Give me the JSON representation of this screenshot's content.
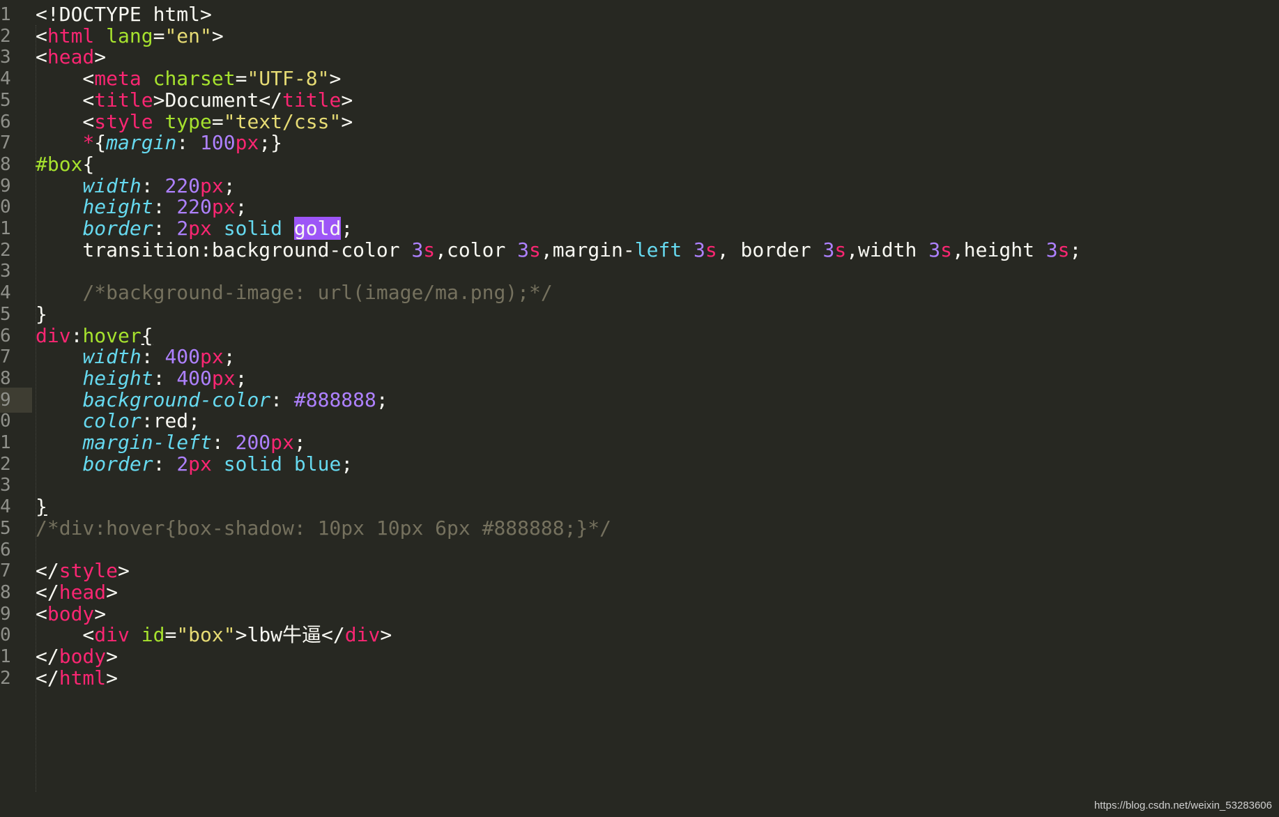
{
  "editor": {
    "theme_colors": {
      "background": "#272822",
      "tag": "#f92672",
      "attribute": "#a6e22e",
      "string": "#e6db74",
      "property": "#66d9ef",
      "number": "#ae81ff",
      "comment": "#75715e",
      "selection": "#9d55f7"
    },
    "active_line": 19,
    "line_numbers": [
      "1",
      "2",
      "3",
      "4",
      "5",
      "6",
      "7",
      "8",
      "9",
      "0",
      "1",
      "2",
      "3",
      "4",
      "5",
      "6",
      "7",
      "8",
      "9",
      "0",
      "1",
      "2",
      "3",
      "4",
      "5",
      "6",
      "7",
      "8",
      "9",
      "0",
      "1",
      "2"
    ],
    "lines": [
      [
        {
          "c": "t-punc",
          "t": "<!DOCTYPE html>"
        }
      ],
      [
        {
          "c": "t-punc",
          "t": "<"
        },
        {
          "c": "t-tag",
          "t": "html"
        },
        {
          "c": "t-punc",
          "t": " "
        },
        {
          "c": "t-attr",
          "t": "lang"
        },
        {
          "c": "t-punc",
          "t": "="
        },
        {
          "c": "t-str",
          "t": "\"en\""
        },
        {
          "c": "t-punc",
          "t": ">"
        }
      ],
      [
        {
          "c": "t-punc",
          "t": "<"
        },
        {
          "c": "t-tag",
          "t": "head"
        },
        {
          "c": "t-punc",
          "t": ">"
        }
      ],
      [
        {
          "c": "t-punc",
          "t": "    <"
        },
        {
          "c": "t-tag",
          "t": "meta"
        },
        {
          "c": "t-punc",
          "t": " "
        },
        {
          "c": "t-attr",
          "t": "charset"
        },
        {
          "c": "t-punc",
          "t": "="
        },
        {
          "c": "t-str",
          "t": "\"UTF-8\""
        },
        {
          "c": "t-punc",
          "t": ">"
        }
      ],
      [
        {
          "c": "t-punc",
          "t": "    <"
        },
        {
          "c": "t-tag",
          "t": "title"
        },
        {
          "c": "t-punc",
          "t": ">"
        },
        {
          "c": "t-plain",
          "t": "Document"
        },
        {
          "c": "t-punc",
          "t": "</"
        },
        {
          "c": "t-tag",
          "t": "title"
        },
        {
          "c": "t-punc",
          "t": ">"
        }
      ],
      [
        {
          "c": "t-punc",
          "t": "    <"
        },
        {
          "c": "t-tag",
          "t": "style"
        },
        {
          "c": "t-punc",
          "t": " "
        },
        {
          "c": "t-attr",
          "t": "type"
        },
        {
          "c": "t-punc",
          "t": "="
        },
        {
          "c": "t-str",
          "t": "\"text/css\""
        },
        {
          "c": "t-punc",
          "t": ">"
        }
      ],
      [
        {
          "c": "t-punc",
          "t": "    "
        },
        {
          "c": "t-tag",
          "t": "*"
        },
        {
          "c": "t-punc",
          "t": "{"
        },
        {
          "c": "t-prop",
          "t": "margin"
        },
        {
          "c": "t-punc",
          "t": ": "
        },
        {
          "c": "t-num",
          "t": "100"
        },
        {
          "c": "t-unit",
          "t": "px"
        },
        {
          "c": "t-punc",
          "t": ";}"
        }
      ],
      [
        {
          "c": "t-id",
          "t": "#box"
        },
        {
          "c": "t-punc",
          "t": "{"
        }
      ],
      [
        {
          "c": "t-punc",
          "t": "    "
        },
        {
          "c": "t-prop",
          "t": "width"
        },
        {
          "c": "t-punc",
          "t": ": "
        },
        {
          "c": "t-num",
          "t": "220"
        },
        {
          "c": "t-unit",
          "t": "px"
        },
        {
          "c": "t-punc",
          "t": ";"
        }
      ],
      [
        {
          "c": "t-punc",
          "t": "    "
        },
        {
          "c": "t-prop",
          "t": "height"
        },
        {
          "c": "t-punc",
          "t": ": "
        },
        {
          "c": "t-num",
          "t": "220"
        },
        {
          "c": "t-unit",
          "t": "px"
        },
        {
          "c": "t-punc",
          "t": ";"
        }
      ],
      [
        {
          "c": "t-punc",
          "t": "    "
        },
        {
          "c": "t-prop",
          "t": "border"
        },
        {
          "c": "t-punc",
          "t": ": "
        },
        {
          "c": "t-num",
          "t": "2"
        },
        {
          "c": "t-unit",
          "t": "px"
        },
        {
          "c": "t-punc",
          "t": " "
        },
        {
          "c": "t-val",
          "t": "solid"
        },
        {
          "c": "t-punc",
          "t": " "
        },
        {
          "c": "t-sel",
          "t": "gold"
        },
        {
          "c": "t-punc",
          "t": ";"
        }
      ],
      [
        {
          "c": "t-punc",
          "t": "    transition:background-color "
        },
        {
          "c": "t-num",
          "t": "3"
        },
        {
          "c": "t-unit",
          "t": "s"
        },
        {
          "c": "t-punc",
          "t": ",color "
        },
        {
          "c": "t-num",
          "t": "3"
        },
        {
          "c": "t-unit",
          "t": "s"
        },
        {
          "c": "t-punc",
          "t": ",margin-"
        },
        {
          "c": "t-val",
          "t": "left"
        },
        {
          "c": "t-punc",
          "t": " "
        },
        {
          "c": "t-num",
          "t": "3"
        },
        {
          "c": "t-unit",
          "t": "s"
        },
        {
          "c": "t-punc",
          "t": ", border "
        },
        {
          "c": "t-num",
          "t": "3"
        },
        {
          "c": "t-unit",
          "t": "s"
        },
        {
          "c": "t-punc",
          "t": ",width "
        },
        {
          "c": "t-num",
          "t": "3"
        },
        {
          "c": "t-unit",
          "t": "s"
        },
        {
          "c": "t-punc",
          "t": ",height "
        },
        {
          "c": "t-num",
          "t": "3"
        },
        {
          "c": "t-unit",
          "t": "s"
        },
        {
          "c": "t-punc",
          "t": ";"
        }
      ],
      [],
      [
        {
          "c": "t-punc",
          "t": "    "
        },
        {
          "c": "t-comment",
          "t": "/*background-image: url(image/ma.png);*/"
        }
      ],
      [
        {
          "c": "t-punc",
          "t": "}"
        }
      ],
      [
        {
          "c": "t-tag",
          "t": "div"
        },
        {
          "c": "t-punc",
          "t": ":"
        },
        {
          "c": "t-attr",
          "t": "hover"
        },
        {
          "c": "t-under",
          "t": "{"
        }
      ],
      [
        {
          "c": "t-punc",
          "t": "    "
        },
        {
          "c": "t-prop",
          "t": "width"
        },
        {
          "c": "t-punc",
          "t": ": "
        },
        {
          "c": "t-num",
          "t": "400"
        },
        {
          "c": "t-unit",
          "t": "px"
        },
        {
          "c": "t-punc",
          "t": ";"
        }
      ],
      [
        {
          "c": "t-punc",
          "t": "    "
        },
        {
          "c": "t-prop",
          "t": "height"
        },
        {
          "c": "t-punc",
          "t": ": "
        },
        {
          "c": "t-num",
          "t": "400"
        },
        {
          "c": "t-unit",
          "t": "px"
        },
        {
          "c": "t-punc",
          "t": ";"
        }
      ],
      [
        {
          "c": "t-punc",
          "t": "    "
        },
        {
          "c": "t-prop",
          "t": "background-color"
        },
        {
          "c": "t-punc",
          "t": ": "
        },
        {
          "c": "t-num",
          "t": "#888888"
        },
        {
          "c": "t-punc",
          "t": ";"
        }
      ],
      [
        {
          "c": "t-punc",
          "t": "    "
        },
        {
          "c": "t-prop",
          "t": "color"
        },
        {
          "c": "t-punc",
          "t": ":"
        },
        {
          "c": "t-plain",
          "t": "red"
        },
        {
          "c": "t-punc",
          "t": ";"
        }
      ],
      [
        {
          "c": "t-punc",
          "t": "    "
        },
        {
          "c": "t-prop",
          "t": "margin-left"
        },
        {
          "c": "t-punc",
          "t": ": "
        },
        {
          "c": "t-num",
          "t": "200"
        },
        {
          "c": "t-unit",
          "t": "px"
        },
        {
          "c": "t-punc",
          "t": ";"
        }
      ],
      [
        {
          "c": "t-punc",
          "t": "    "
        },
        {
          "c": "t-prop",
          "t": "border"
        },
        {
          "c": "t-punc",
          "t": ": "
        },
        {
          "c": "t-num",
          "t": "2"
        },
        {
          "c": "t-unit",
          "t": "px"
        },
        {
          "c": "t-punc",
          "t": " "
        },
        {
          "c": "t-val",
          "t": "solid"
        },
        {
          "c": "t-punc",
          "t": " "
        },
        {
          "c": "t-val",
          "t": "blue"
        },
        {
          "c": "t-punc",
          "t": ";"
        }
      ],
      [],
      [
        {
          "c": "t-under",
          "t": "}"
        }
      ],
      [
        {
          "c": "t-comment",
          "t": "/*div:hover{box-shadow: 10px 10px 6px #888888;}*/"
        }
      ],
      [],
      [
        {
          "c": "t-punc",
          "t": "</"
        },
        {
          "c": "t-tag",
          "t": "style"
        },
        {
          "c": "t-punc",
          "t": ">"
        }
      ],
      [
        {
          "c": "t-punc",
          "t": "</"
        },
        {
          "c": "t-tag",
          "t": "head"
        },
        {
          "c": "t-punc",
          "t": ">"
        }
      ],
      [
        {
          "c": "t-punc",
          "t": "<"
        },
        {
          "c": "t-tag",
          "t": "body"
        },
        {
          "c": "t-punc",
          "t": ">"
        }
      ],
      [
        {
          "c": "t-punc",
          "t": "    <"
        },
        {
          "c": "t-tag",
          "t": "div"
        },
        {
          "c": "t-punc",
          "t": " "
        },
        {
          "c": "t-attr",
          "t": "id"
        },
        {
          "c": "t-punc",
          "t": "="
        },
        {
          "c": "t-str",
          "t": "\"box\""
        },
        {
          "c": "t-punc",
          "t": ">"
        },
        {
          "c": "t-plain",
          "t": "lbw牛逼"
        },
        {
          "c": "t-punc",
          "t": "</"
        },
        {
          "c": "t-tag",
          "t": "div"
        },
        {
          "c": "t-punc",
          "t": ">"
        }
      ],
      [
        {
          "c": "t-punc",
          "t": "</"
        },
        {
          "c": "t-tag",
          "t": "body"
        },
        {
          "c": "t-punc",
          "t": ">"
        }
      ],
      [
        {
          "c": "t-punc",
          "t": "</"
        },
        {
          "c": "t-tag",
          "t": "html"
        },
        {
          "c": "t-punc",
          "t": ">"
        }
      ]
    ]
  },
  "watermark": {
    "text": "https://blog.csdn.net/weixin_53283606"
  }
}
